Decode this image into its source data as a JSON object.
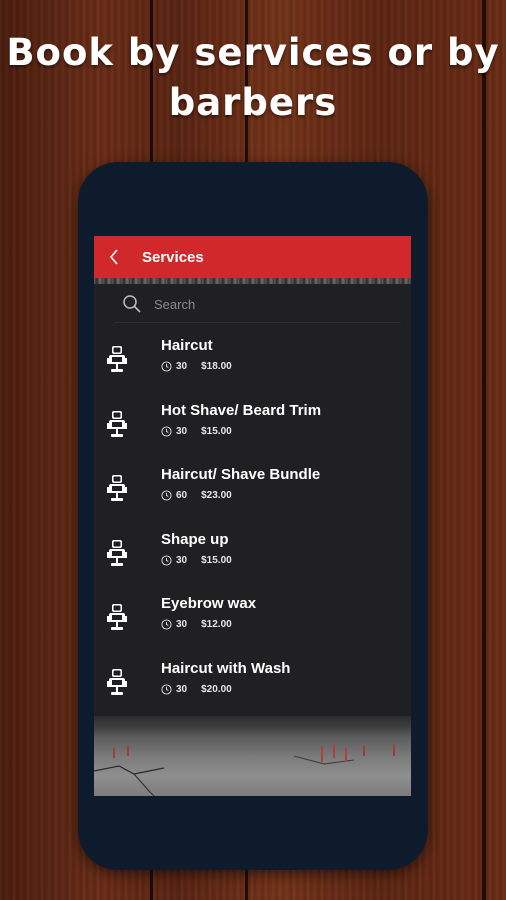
{
  "headline": {
    "line1": "Book by services or by",
    "line2": "barbers"
  },
  "appbar": {
    "back_icon": "chevron-left-icon",
    "title": "Services",
    "color": "#d0282b"
  },
  "search": {
    "placeholder": "Search",
    "icon": "search-icon"
  },
  "services": [
    {
      "name": "Haircut",
      "duration": "30",
      "price": "$18.00"
    },
    {
      "name": "Hot Shave/ Beard Trim",
      "duration": "30",
      "price": "$15.00"
    },
    {
      "name": "Haircut/ Shave Bundle",
      "duration": "60",
      "price": "$23.00"
    },
    {
      "name": "Shape up",
      "duration": "30",
      "price": "$15.00"
    },
    {
      "name": "Eyebrow wax",
      "duration": "30",
      "price": "$12.00"
    },
    {
      "name": "Haircut with Wash",
      "duration": "30",
      "price": "$20.00"
    }
  ]
}
